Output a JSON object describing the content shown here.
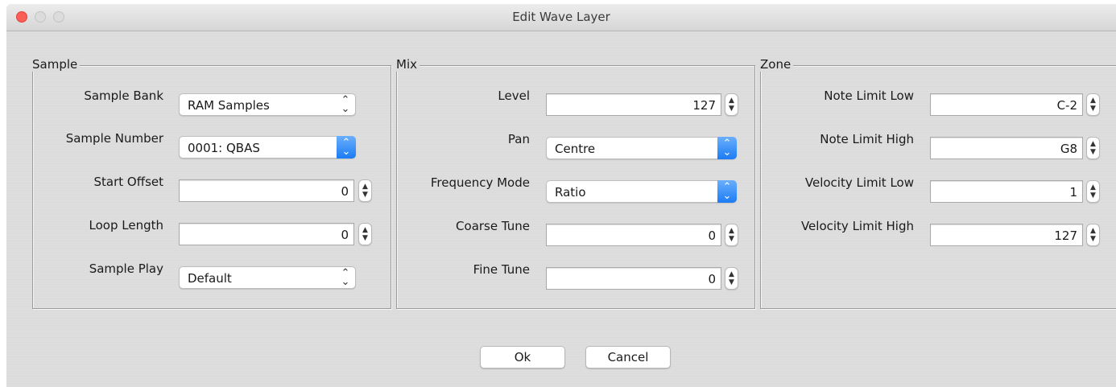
{
  "window": {
    "title": "Edit Wave Layer"
  },
  "sample": {
    "legend": "Sample",
    "bank_label": "Sample Bank",
    "bank_value": "RAM Samples",
    "number_label": "Sample Number",
    "number_value": "0001: QBAS",
    "start_offset_label": "Start Offset",
    "start_offset_value": "0",
    "loop_length_label": "Loop Length",
    "loop_length_value": "0",
    "play_label": "Sample Play",
    "play_value": "Default"
  },
  "mix": {
    "legend": "Mix",
    "level_label": "Level",
    "level_value": "127",
    "pan_label": "Pan",
    "pan_value": "Centre",
    "freq_mode_label": "Frequency Mode",
    "freq_mode_value": "Ratio",
    "coarse_label": "Coarse Tune",
    "coarse_value": "0",
    "fine_label": "Fine Tune",
    "fine_value": "0"
  },
  "zone": {
    "legend": "Zone",
    "note_low_label": "Note Limit Low",
    "note_low_value": "C-2",
    "note_high_label": "Note Limit High",
    "note_high_value": "G8",
    "vel_low_label": "Velocity Limit Low",
    "vel_low_value": "1",
    "vel_high_label": "Velocity Limit High",
    "vel_high_value": "127"
  },
  "buttons": {
    "ok": "Ok",
    "cancel": "Cancel"
  },
  "icons": {
    "close": "close-traffic-light-icon",
    "minimize": "minimize-traffic-light-icon",
    "maximize": "zoom-traffic-light-icon",
    "select_arrows": "up-down-chevron-icon",
    "stepper": "stepper-arrows-icon"
  },
  "colors": {
    "accent": "#1c7cf4",
    "close": "#fb5f57"
  }
}
